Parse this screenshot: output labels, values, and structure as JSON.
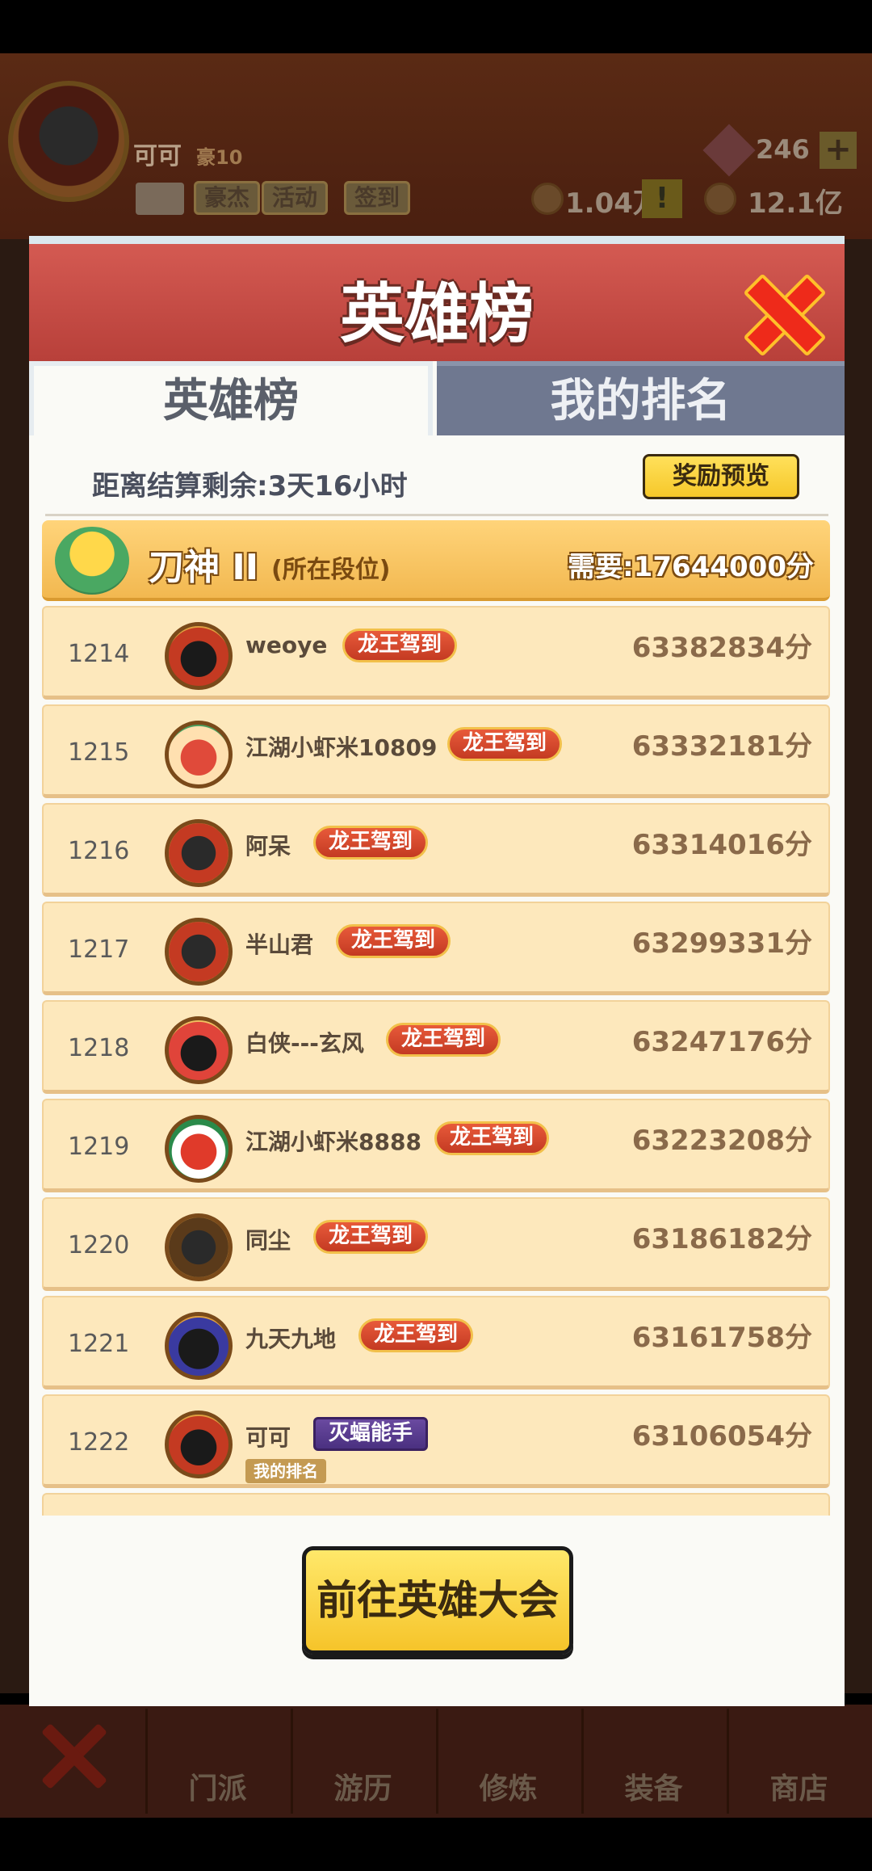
{
  "background": {
    "player_name": "可可",
    "player_rank": "豪10",
    "buttons": [
      "豪杰",
      "活动",
      "签到"
    ],
    "gem_count": "246",
    "gem_add": "+",
    "resource1": "1.04万",
    "resource_alert": "!",
    "resource2": "12.1亿",
    "nav_items": [
      "门派",
      "游历",
      "修炼",
      "装备",
      "商店"
    ]
  },
  "modal": {
    "title": "英雄榜",
    "tabs": [
      "英雄榜",
      "我的排名"
    ],
    "countdown": "距离结算剩余:3天16小时",
    "reward_preview": "奖励预览",
    "tier": {
      "name": "刀神 II",
      "note": "(所在段位)",
      "requirement": "需要:17644000分"
    },
    "rows": [
      {
        "rank": "1214",
        "name": "weoye",
        "badge": "龙王驾到",
        "score": "63382834分"
      },
      {
        "rank": "1215",
        "name": "江湖小虾米10809",
        "badge": "龙王驾到",
        "score": "63332181分"
      },
      {
        "rank": "1216",
        "name": "阿呆",
        "badge": "龙王驾到",
        "score": "63314016分"
      },
      {
        "rank": "1217",
        "name": "半山君",
        "badge": "龙王驾到",
        "score": "63299331分"
      },
      {
        "rank": "1218",
        "name": "白侠---玄风",
        "badge": "龙王驾到",
        "score": "63247176分"
      },
      {
        "rank": "1219",
        "name": "江湖小虾米8888",
        "badge": "龙王驾到",
        "score": "63223208分"
      },
      {
        "rank": "1220",
        "name": "同尘",
        "badge": "龙王驾到",
        "score": "63186182分"
      },
      {
        "rank": "1221",
        "name": "九天九地",
        "badge": "龙王驾到",
        "score": "63161758分"
      },
      {
        "rank": "1222",
        "name": "可可",
        "badge": "灭蝠能手",
        "score": "63106054分",
        "tag": "我的排名"
      }
    ],
    "go_button": "前往英雄大会"
  },
  "colors": {
    "header": "#c4463e",
    "row_bg": "#fde8bc",
    "badge": "#d84a2e",
    "button": "#f8d040"
  }
}
